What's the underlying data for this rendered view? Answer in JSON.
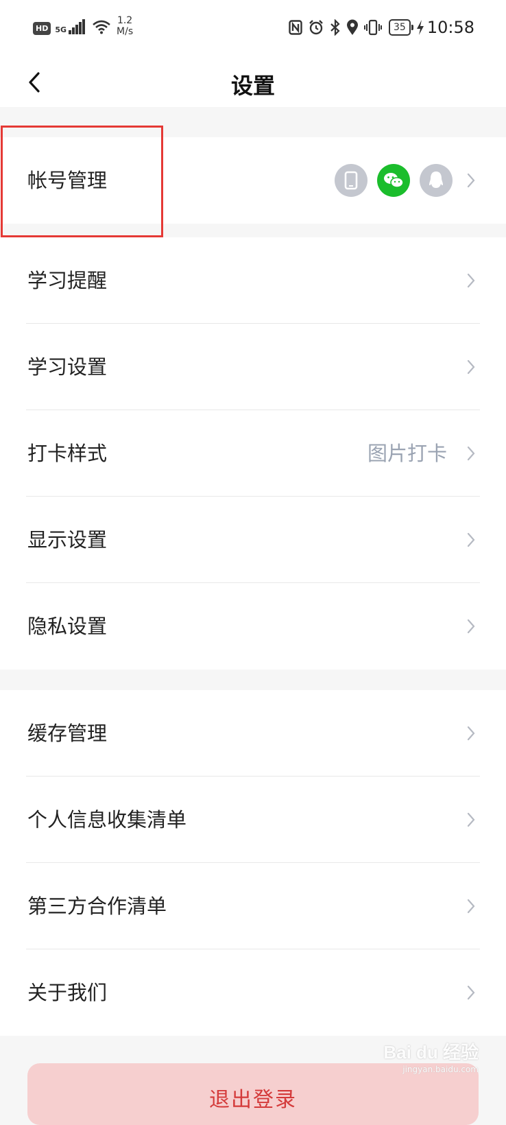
{
  "status_bar": {
    "hd": "HD",
    "network": "5G",
    "speed_top": "1.2",
    "speed_bottom": "M/s",
    "battery": "35",
    "time": "10:58"
  },
  "navbar": {
    "title": "设置"
  },
  "account_section": {
    "label": "帐号管理",
    "linked_icons": [
      "phone-icon",
      "wechat-icon",
      "qq-icon"
    ],
    "colors": {
      "wechat": "#1bbd2c",
      "neutral": "#c4c7cf",
      "highlight": "#e53935"
    }
  },
  "section2": [
    {
      "label": "学习提醒"
    },
    {
      "label": "学习设置"
    },
    {
      "label": "打卡样式",
      "value": "图片打卡"
    },
    {
      "label": "显示设置"
    },
    {
      "label": "隐私设置"
    }
  ],
  "section3": [
    {
      "label": "缓存管理"
    },
    {
      "label": "个人信息收集清单"
    },
    {
      "label": "第三方合作清单"
    },
    {
      "label": "关于我们"
    }
  ],
  "logout": {
    "label": "退出登录",
    "color": "#d43a3a"
  },
  "watermark": {
    "text": "Bai du 经验",
    "sub": "jingyan.baidu.com"
  }
}
